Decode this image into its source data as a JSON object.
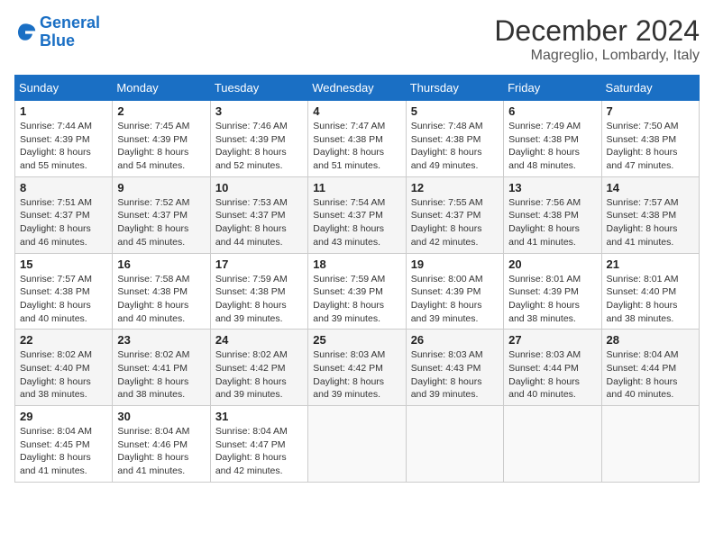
{
  "header": {
    "logo_line1": "General",
    "logo_line2": "Blue",
    "month": "December 2024",
    "location": "Magreglio, Lombardy, Italy"
  },
  "weekdays": [
    "Sunday",
    "Monday",
    "Tuesday",
    "Wednesday",
    "Thursday",
    "Friday",
    "Saturday"
  ],
  "weeks": [
    [
      {
        "day": "1",
        "sunrise": "7:44 AM",
        "sunset": "4:39 PM",
        "hours": "8",
        "minutes": "55"
      },
      {
        "day": "2",
        "sunrise": "7:45 AM",
        "sunset": "4:39 PM",
        "hours": "8",
        "minutes": "54"
      },
      {
        "day": "3",
        "sunrise": "7:46 AM",
        "sunset": "4:39 PM",
        "hours": "8",
        "minutes": "52"
      },
      {
        "day": "4",
        "sunrise": "7:47 AM",
        "sunset": "4:38 PM",
        "hours": "8",
        "minutes": "51"
      },
      {
        "day": "5",
        "sunrise": "7:48 AM",
        "sunset": "4:38 PM",
        "hours": "8",
        "minutes": "49"
      },
      {
        "day": "6",
        "sunrise": "7:49 AM",
        "sunset": "4:38 PM",
        "hours": "8",
        "minutes": "48"
      },
      {
        "day": "7",
        "sunrise": "7:50 AM",
        "sunset": "4:38 PM",
        "hours": "8",
        "minutes": "47"
      }
    ],
    [
      {
        "day": "8",
        "sunrise": "7:51 AM",
        "sunset": "4:37 PM",
        "hours": "8",
        "minutes": "46"
      },
      {
        "day": "9",
        "sunrise": "7:52 AM",
        "sunset": "4:37 PM",
        "hours": "8",
        "minutes": "45"
      },
      {
        "day": "10",
        "sunrise": "7:53 AM",
        "sunset": "4:37 PM",
        "hours": "8",
        "minutes": "44"
      },
      {
        "day": "11",
        "sunrise": "7:54 AM",
        "sunset": "4:37 PM",
        "hours": "8",
        "minutes": "43"
      },
      {
        "day": "12",
        "sunrise": "7:55 AM",
        "sunset": "4:37 PM",
        "hours": "8",
        "minutes": "42"
      },
      {
        "day": "13",
        "sunrise": "7:56 AM",
        "sunset": "4:38 PM",
        "hours": "8",
        "minutes": "41"
      },
      {
        "day": "14",
        "sunrise": "7:57 AM",
        "sunset": "4:38 PM",
        "hours": "8",
        "minutes": "41"
      }
    ],
    [
      {
        "day": "15",
        "sunrise": "7:57 AM",
        "sunset": "4:38 PM",
        "hours": "8",
        "minutes": "40"
      },
      {
        "day": "16",
        "sunrise": "7:58 AM",
        "sunset": "4:38 PM",
        "hours": "8",
        "minutes": "40"
      },
      {
        "day": "17",
        "sunrise": "7:59 AM",
        "sunset": "4:38 PM",
        "hours": "8",
        "minutes": "39"
      },
      {
        "day": "18",
        "sunrise": "7:59 AM",
        "sunset": "4:39 PM",
        "hours": "8",
        "minutes": "39"
      },
      {
        "day": "19",
        "sunrise": "8:00 AM",
        "sunset": "4:39 PM",
        "hours": "8",
        "minutes": "39"
      },
      {
        "day": "20",
        "sunrise": "8:01 AM",
        "sunset": "4:39 PM",
        "hours": "8",
        "minutes": "38"
      },
      {
        "day": "21",
        "sunrise": "8:01 AM",
        "sunset": "4:40 PM",
        "hours": "8",
        "minutes": "38"
      }
    ],
    [
      {
        "day": "22",
        "sunrise": "8:02 AM",
        "sunset": "4:40 PM",
        "hours": "8",
        "minutes": "38"
      },
      {
        "day": "23",
        "sunrise": "8:02 AM",
        "sunset": "4:41 PM",
        "hours": "8",
        "minutes": "38"
      },
      {
        "day": "24",
        "sunrise": "8:02 AM",
        "sunset": "4:42 PM",
        "hours": "8",
        "minutes": "39"
      },
      {
        "day": "25",
        "sunrise": "8:03 AM",
        "sunset": "4:42 PM",
        "hours": "8",
        "minutes": "39"
      },
      {
        "day": "26",
        "sunrise": "8:03 AM",
        "sunset": "4:43 PM",
        "hours": "8",
        "minutes": "39"
      },
      {
        "day": "27",
        "sunrise": "8:03 AM",
        "sunset": "4:44 PM",
        "hours": "8",
        "minutes": "40"
      },
      {
        "day": "28",
        "sunrise": "8:04 AM",
        "sunset": "4:44 PM",
        "hours": "8",
        "minutes": "40"
      }
    ],
    [
      {
        "day": "29",
        "sunrise": "8:04 AM",
        "sunset": "4:45 PM",
        "hours": "8",
        "minutes": "41"
      },
      {
        "day": "30",
        "sunrise": "8:04 AM",
        "sunset": "4:46 PM",
        "hours": "8",
        "minutes": "41"
      },
      {
        "day": "31",
        "sunrise": "8:04 AM",
        "sunset": "4:47 PM",
        "hours": "8",
        "minutes": "42"
      },
      null,
      null,
      null,
      null
    ]
  ]
}
